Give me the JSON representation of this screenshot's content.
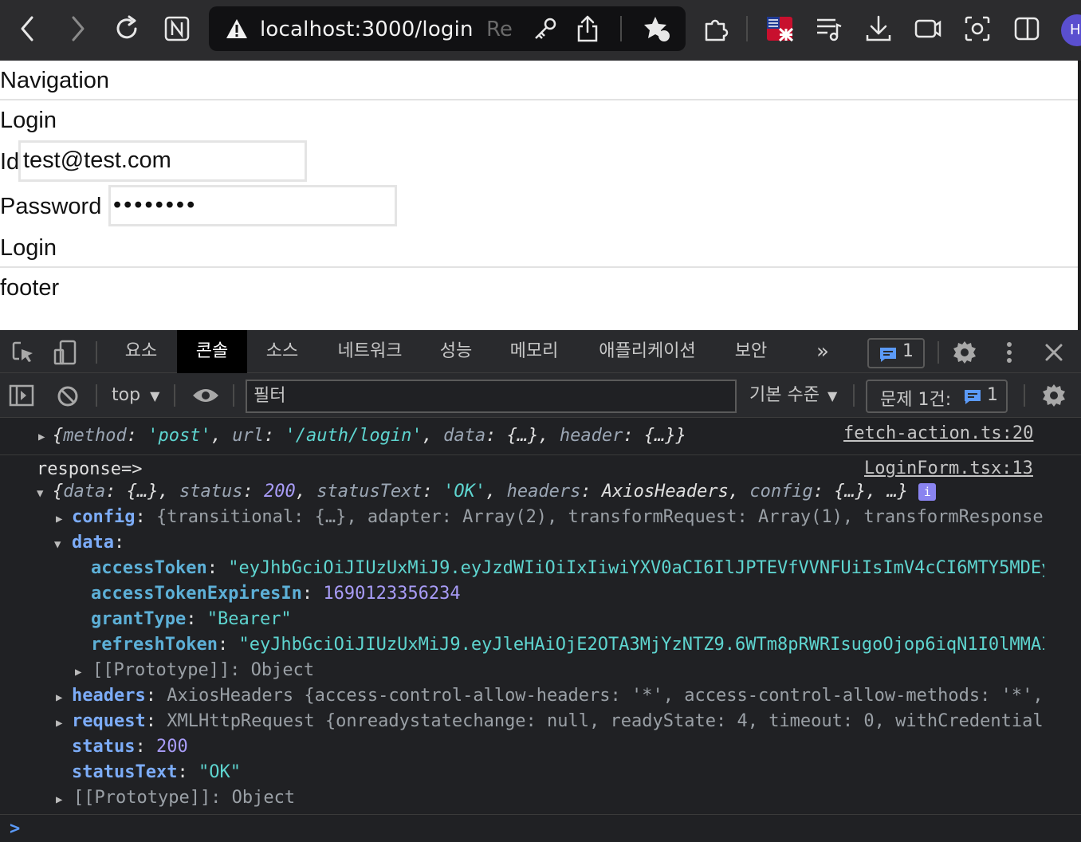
{
  "toolbar": {
    "url": "localhost:3000/login",
    "url_suffix": "Re",
    "profile_initial": "H"
  },
  "page": {
    "nav_label": "Navigation",
    "heading": "Login",
    "id_label": "Id",
    "id_value": "test@test.com",
    "password_label": "Password",
    "password_value": "••••••••",
    "login_button": "Login",
    "footer": "footer"
  },
  "devtools": {
    "tabs": [
      "요소",
      "콘솔",
      "소스",
      "네트워크",
      "성능",
      "메모리",
      "애플리케이션",
      "보안"
    ],
    "active_tab": "콘솔",
    "messages_count": "1",
    "context": "top",
    "filter_placeholder": "필터",
    "level": "기본 수준",
    "issues_label": "문제 1건:",
    "issues_count": "1"
  },
  "console": {
    "log1": {
      "text_open": "{",
      "method_key": "method",
      "method_val": "'post'",
      "url_key": "url",
      "url_val": "'/auth/login'",
      "data_key": "data",
      "data_val": "{…}",
      "header_key": "header",
      "header_val": "{…}",
      "text_close": "}",
      "source": "fetch-action.ts:20"
    },
    "log2": {
      "label": "response=>",
      "source": "LoginForm.tsx:13",
      "summary": {
        "data_key": "data",
        "data_val": "{…}",
        "status_key": "status",
        "status_val": "200",
        "statusText_key": "statusText",
        "statusText_val": "'OK'",
        "headers_key": "headers",
        "headers_val": "AxiosHeaders",
        "config_key": "config",
        "config_val": "{…}",
        "more": "…}",
        "info_badge": "i"
      },
      "config_line": {
        "key": "config",
        "rest": "{transitional: {…}, adapter: Array(2), transformRequest: Array(1), transformResponse"
      },
      "data_key": "data",
      "accessToken_key": "accessToken",
      "accessToken_val": "\"eyJhbGciOiJIUzUxMiJ9.eyJzdWIiOiIxIiwiYXV0aCI6IlJPTEVfVVNFUiIsImV4cCI6MTY5MDEy",
      "accessTokenExpiresIn_key": "accessTokenExpiresIn",
      "accessTokenExpiresIn_val": "1690123356234",
      "grantType_key": "grantType",
      "grantType_val": "\"Bearer\"",
      "refreshToken_key": "refreshToken",
      "refreshToken_val": "\"eyJhbGciOiJIUzUxMiJ9.eyJleHAiOjE2OTA3MjYzNTZ9.6WTm8pRWRIsugoOjop6iqN1I0lMMAI",
      "proto1": "[[Prototype]]: Object",
      "headers_key": "headers",
      "headers_rest": "AxiosHeaders {access-control-allow-headers: '*', access-control-allow-methods: '*',",
      "request_key": "request",
      "request_rest": "XMLHttpRequest {onreadystatechange: null, readyState: 4, timeout: 0, withCredential",
      "status_key": "status",
      "status_val": "200",
      "statusText_key": "statusText",
      "statusText_val": "\"OK\"",
      "proto2": "[[Prototype]]: Object"
    },
    "prompt": ">"
  }
}
